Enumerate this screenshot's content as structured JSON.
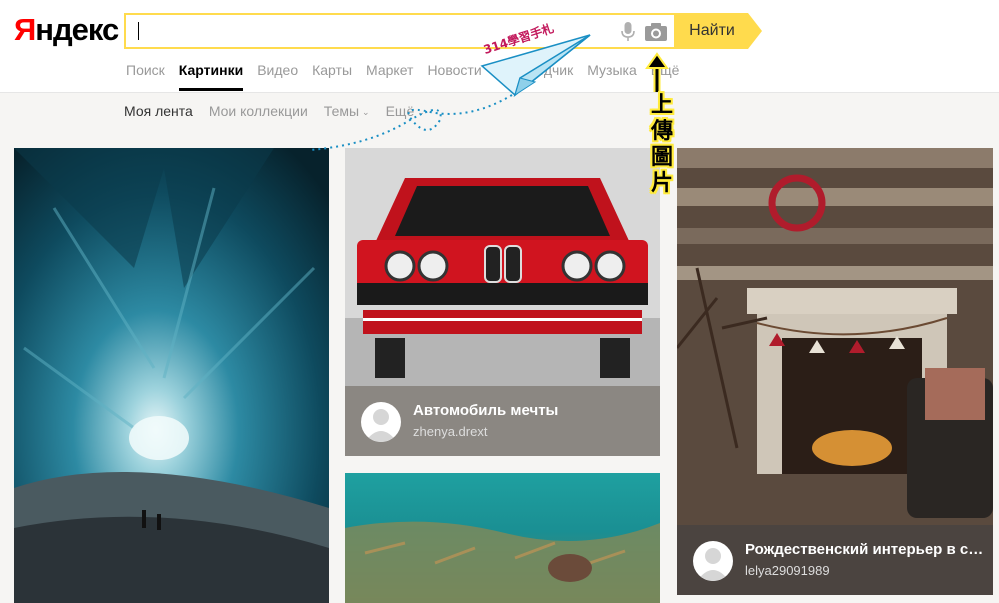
{
  "logo": {
    "first_letter": "Я",
    "rest": "ндекс"
  },
  "search": {
    "value": "",
    "button_label": "Найти"
  },
  "services": [
    {
      "label": "Поиск",
      "active": false
    },
    {
      "label": "Картинки",
      "active": true
    },
    {
      "label": "Видео",
      "active": false
    },
    {
      "label": "Карты",
      "active": false
    },
    {
      "label": "Маркет",
      "active": false
    },
    {
      "label": "Новости",
      "active": false
    },
    {
      "label": "Переводчик",
      "active": false
    },
    {
      "label": "Музыка",
      "active": false
    },
    {
      "label": "Ещё",
      "active": false
    }
  ],
  "subnav": [
    {
      "label": "Моя лента",
      "active": true
    },
    {
      "label": "Мои коллекции",
      "active": false
    },
    {
      "label": "Темы",
      "active": false,
      "chevron": true
    },
    {
      "label": "Ещё",
      "active": false,
      "chevron": true
    }
  ],
  "cards": [
    {
      "id": "ice-cave",
      "caption": null
    },
    {
      "id": "red-car",
      "caption": {
        "title": "Автомобиль мечты",
        "user": "zhenya.drext",
        "bg": "#8b8782"
      }
    },
    {
      "id": "fireplace",
      "caption": {
        "title": "Рождественский интерьер в ск...",
        "user": "lelya29091989",
        "bg": "#4b4440"
      }
    },
    {
      "id": "underwater",
      "caption": null
    }
  ],
  "annotation": {
    "vertical_text": "上傳圖片",
    "stamp_text": "314學習手札"
  },
  "colors": {
    "accent": "#ffdb4d",
    "logo_red": "#ff0000",
    "annotation_yellow": "#ffeb3b",
    "arrow_blue": "#1a8fc4"
  }
}
